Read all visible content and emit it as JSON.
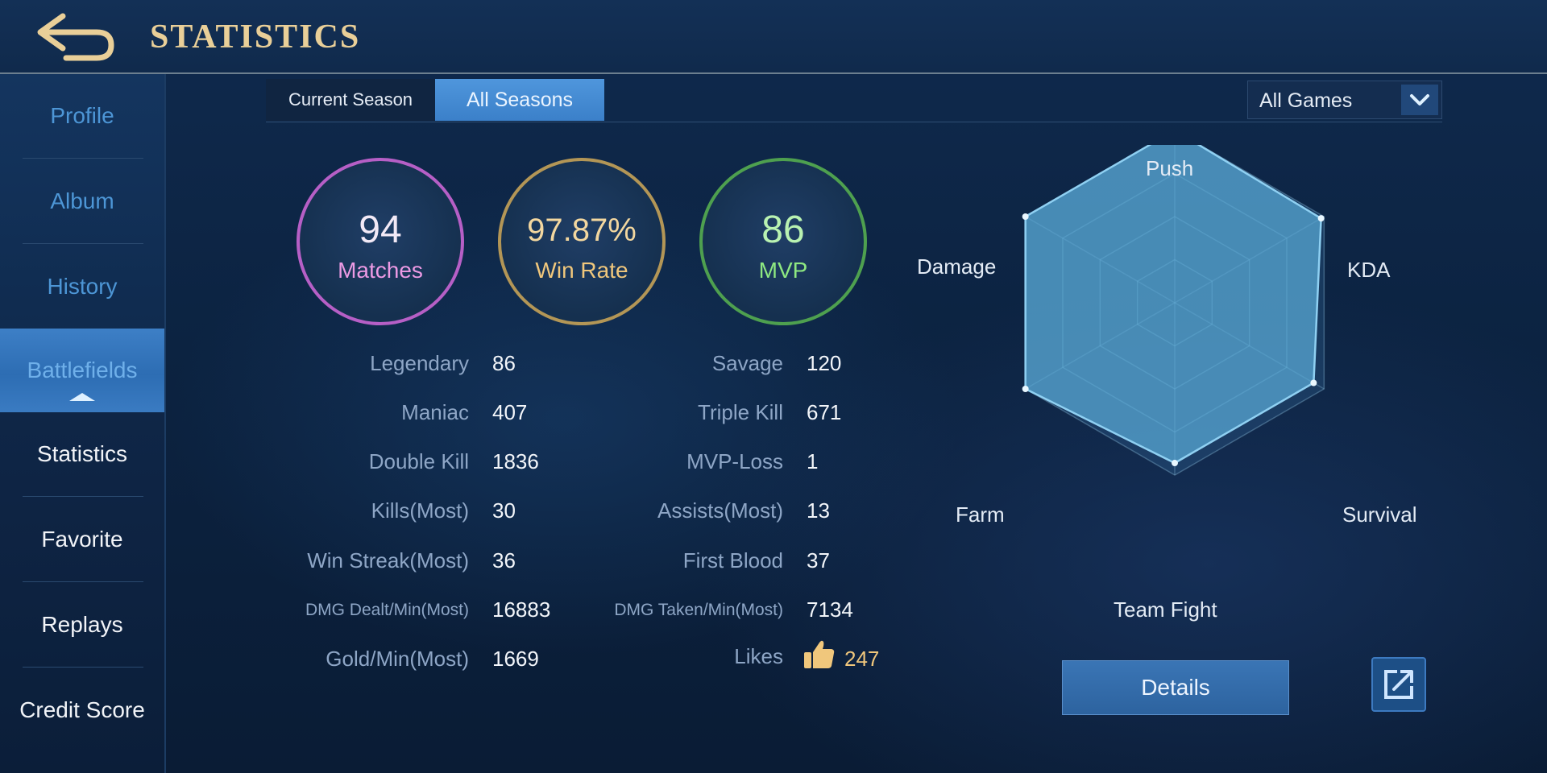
{
  "header": {
    "title": "STATISTICS",
    "back_icon": "back-arrow-icon"
  },
  "sidebar": {
    "items": [
      {
        "label": "Profile"
      },
      {
        "label": "Album"
      },
      {
        "label": "History"
      },
      {
        "label": "Battlefields"
      },
      {
        "label": "Statistics"
      },
      {
        "label": "Favorite"
      },
      {
        "label": "Replays"
      },
      {
        "label": "Credit Score"
      }
    ]
  },
  "tabs": {
    "current_season": "Current Season",
    "all_seasons": "All Seasons"
  },
  "filter": {
    "selected": "All Games",
    "icon": "chevron-down-icon"
  },
  "summary": {
    "matches_value": "94",
    "matches_label": "Matches",
    "winrate_value": "97.87%",
    "winrate_label": "Win Rate",
    "mvp_value": "86",
    "mvp_label": "MVP"
  },
  "stats": {
    "left": [
      {
        "label": "Legendary",
        "value": "86"
      },
      {
        "label": "Maniac",
        "value": "407"
      },
      {
        "label": "Double Kill",
        "value": "1836"
      },
      {
        "label": "Kills(Most)",
        "value": "30"
      },
      {
        "label": "Win Streak(Most)",
        "value": "36"
      },
      {
        "label": "DMG Dealt/Min(Most)",
        "value": "16883"
      },
      {
        "label": "Gold/Min(Most)",
        "value": "1669"
      }
    ],
    "right": [
      {
        "label": "Savage",
        "value": "120"
      },
      {
        "label": "Triple Kill",
        "value": "671"
      },
      {
        "label": "MVP-Loss",
        "value": "1"
      },
      {
        "label": "Assists(Most)",
        "value": "13"
      },
      {
        "label": "First Blood",
        "value": "37"
      },
      {
        "label": "DMG Taken/Min(Most)",
        "value": "7134"
      },
      {
        "label": "Likes",
        "value": "247"
      }
    ]
  },
  "radar": {
    "axes": [
      {
        "label": "Push",
        "level": 1.0
      },
      {
        "label": "KDA",
        "level": 0.98
      },
      {
        "label": "Survival",
        "level": 0.93
      },
      {
        "label": "Team Fight",
        "level": 0.93
      },
      {
        "label": "Farm",
        "level": 1.0
      },
      {
        "label": "Damage",
        "level": 1.0
      }
    ]
  },
  "actions": {
    "details_label": "Details",
    "share_icon": "external-link-icon"
  },
  "colors": {
    "matches": "#b65fc6",
    "win_rate": "#b39656",
    "mvp": "#4ea04f",
    "accent": "#3b80c9",
    "title": "#e9cf98"
  }
}
